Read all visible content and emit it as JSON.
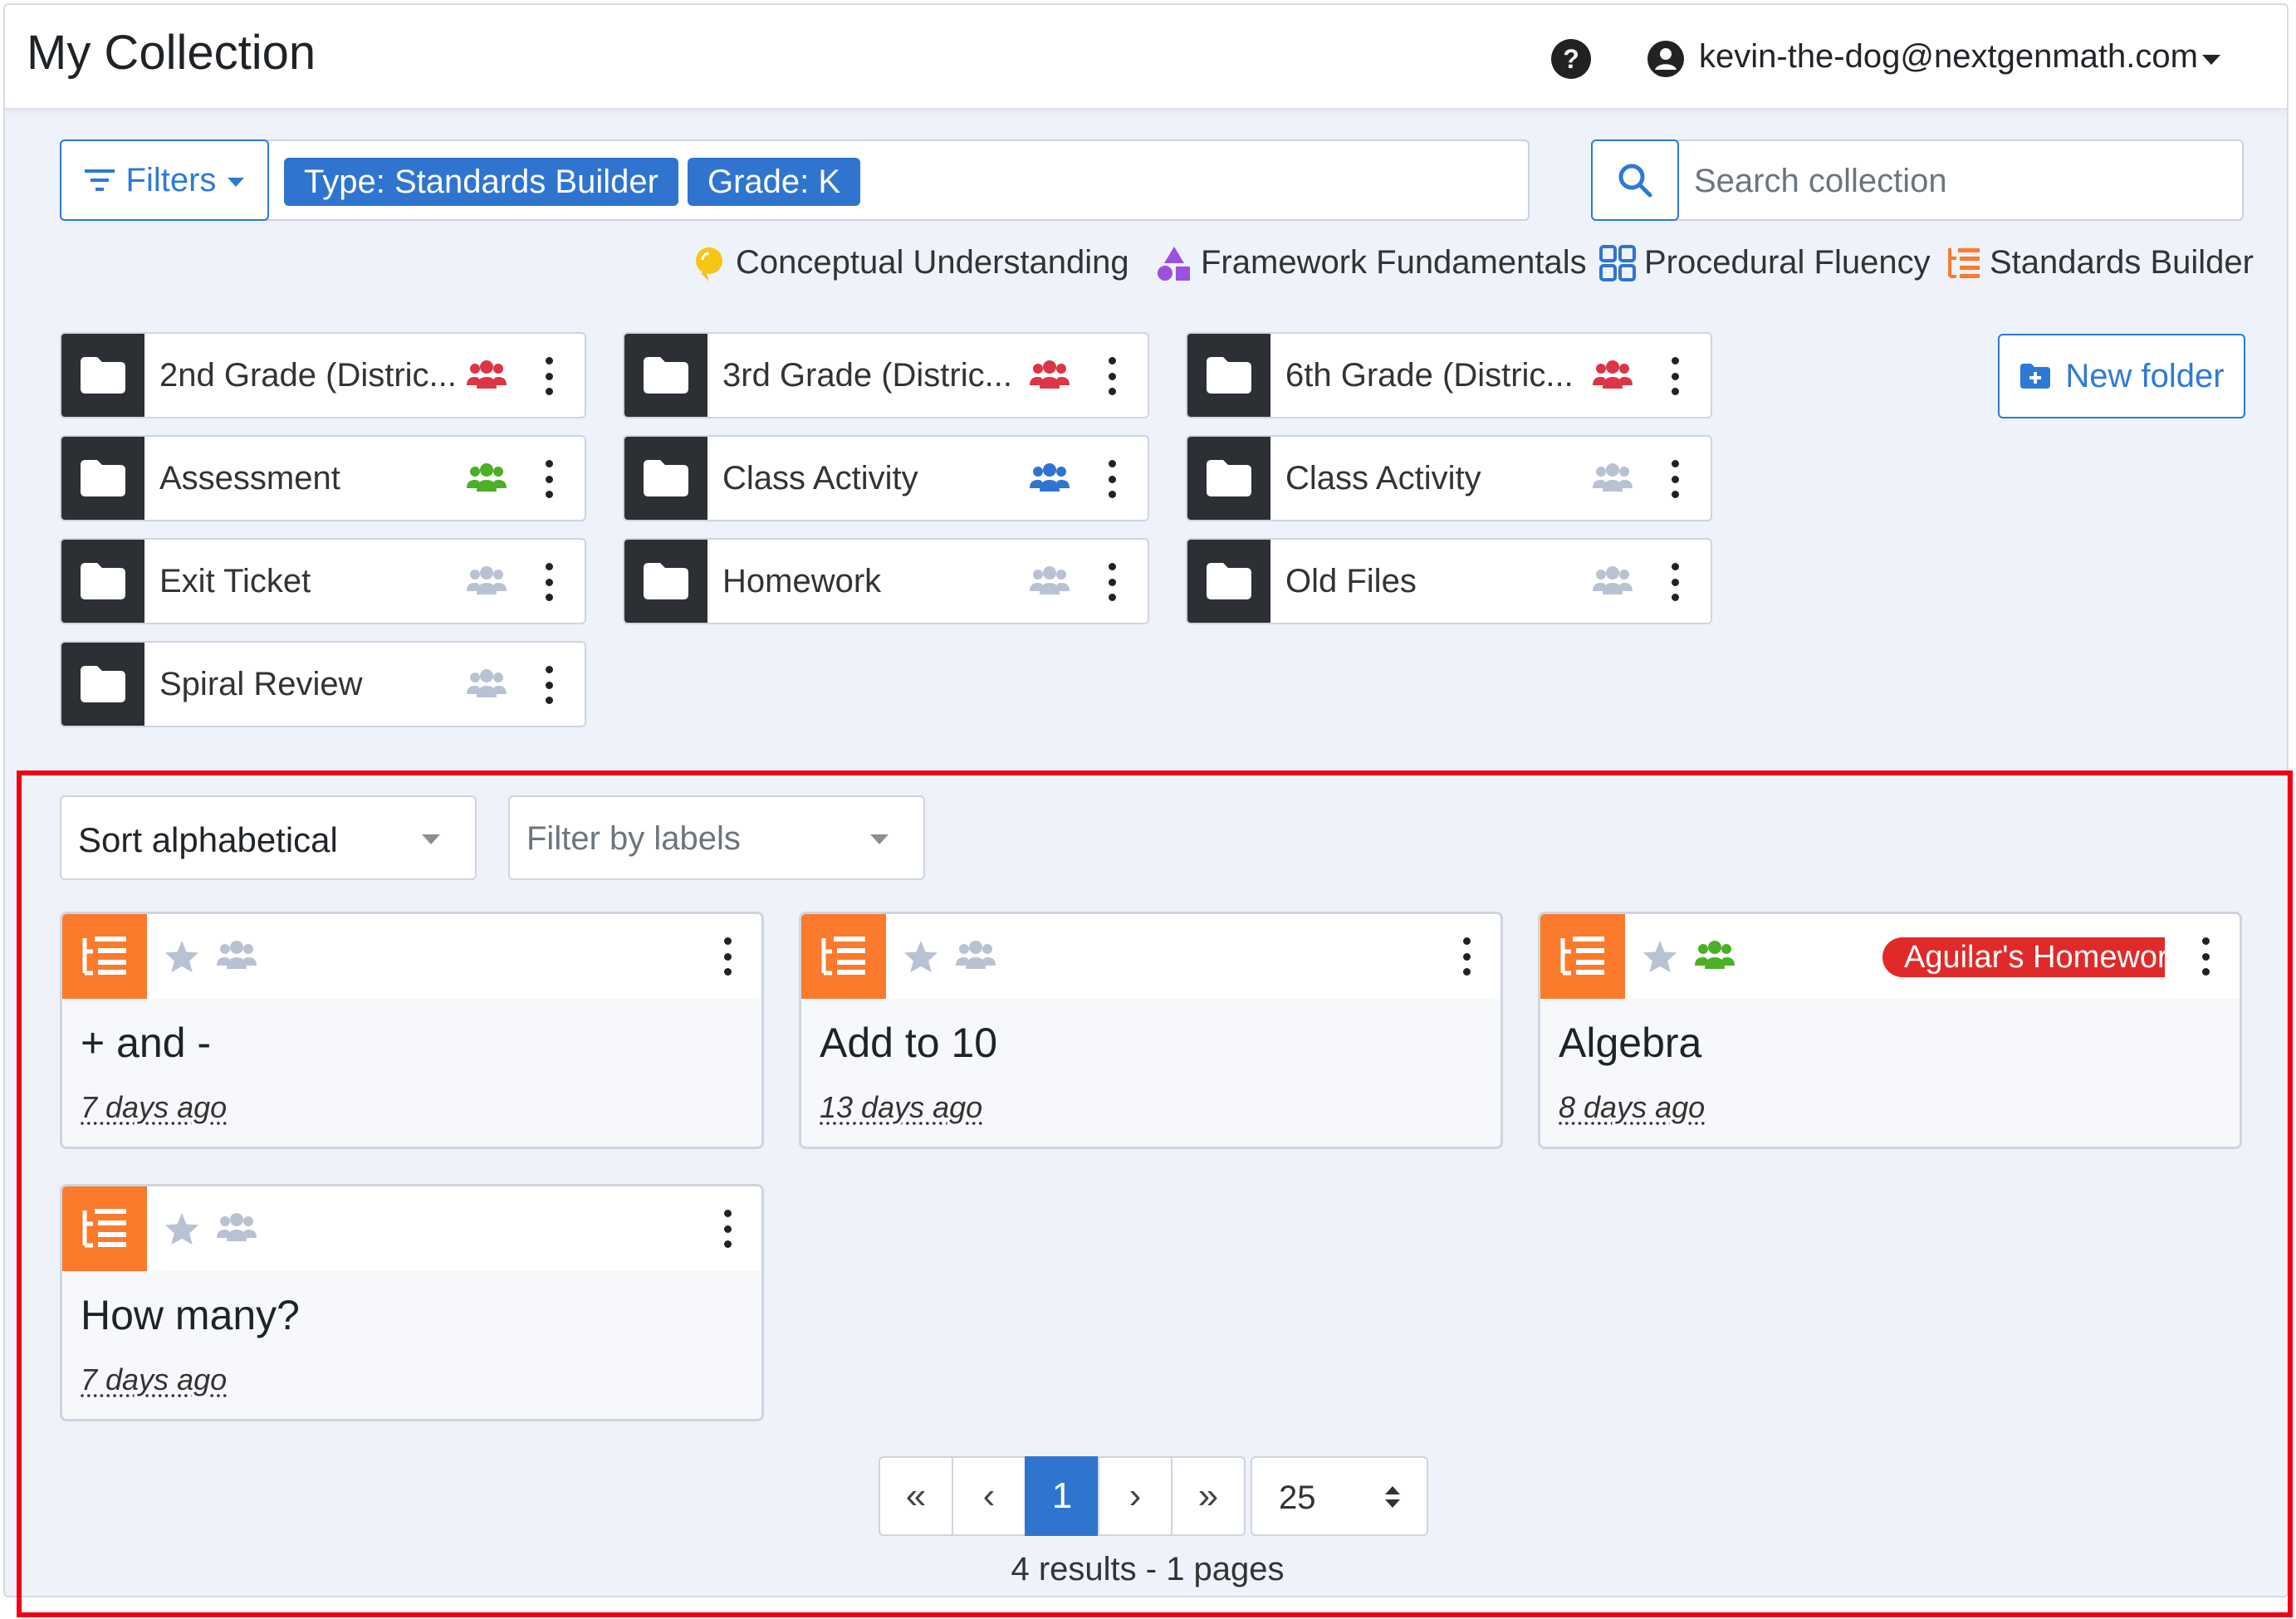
{
  "header": {
    "title": "My Collection",
    "user_email": "kevin-the-dog@nextgenmath.com"
  },
  "filters": {
    "button_label": "Filters",
    "chips": [
      "Type: Standards Builder",
      "Grade: K"
    ]
  },
  "search": {
    "placeholder": "Search collection"
  },
  "legend": [
    {
      "label": "Conceptual Understanding",
      "icon": "lightbulb-icon",
      "color": "#f5c518"
    },
    {
      "label": "Framework Fundamentals",
      "icon": "shapes-icon",
      "color": "#9b51e0"
    },
    {
      "label": "Procedural Fluency",
      "icon": "grid-icon",
      "color": "#2f75d0"
    },
    {
      "label": "Standards Builder",
      "icon": "list-tree-icon",
      "color": "#fb7a2b"
    }
  ],
  "folders": [
    {
      "name": "2nd Grade (Distric...",
      "share": "red"
    },
    {
      "name": "3rd Grade (Distric...",
      "share": "red"
    },
    {
      "name": "6th Grade (Distric...",
      "share": "red"
    },
    {
      "name": "Assessment",
      "share": "green"
    },
    {
      "name": "Class Activity",
      "share": "blue"
    },
    {
      "name": "Class Activity",
      "share": "gray"
    },
    {
      "name": "Exit Ticket",
      "share": "gray"
    },
    {
      "name": "Homework",
      "share": "gray"
    },
    {
      "name": "Old Files",
      "share": "gray"
    },
    {
      "name": "Spiral Review",
      "share": "gray"
    }
  ],
  "share_colors": {
    "red": "#dc3545",
    "green": "#4caf25",
    "blue": "#2f75d0",
    "gray": "#b9c2d3"
  },
  "new_folder_label": "New folder",
  "sort": {
    "selected": "Sort alphabetical"
  },
  "label_filter": {
    "placeholder": "Filter by labels"
  },
  "cards": [
    {
      "title": "+ and -",
      "date": "7 days ago",
      "share": "gray",
      "label": ""
    },
    {
      "title": "Add to 10",
      "date": "13 days ago",
      "share": "gray",
      "label": ""
    },
    {
      "title": "Algebra",
      "date": "8 days ago",
      "share": "green",
      "label": "Aguilar's Homework"
    },
    {
      "title": "How many?",
      "date": "7 days ago",
      "share": "gray",
      "label": ""
    }
  ],
  "pagination": {
    "first": "«",
    "prev": "‹",
    "current": "1",
    "next": "›",
    "last": "»",
    "per_page": "25",
    "summary": "4 results - 1 pages"
  }
}
